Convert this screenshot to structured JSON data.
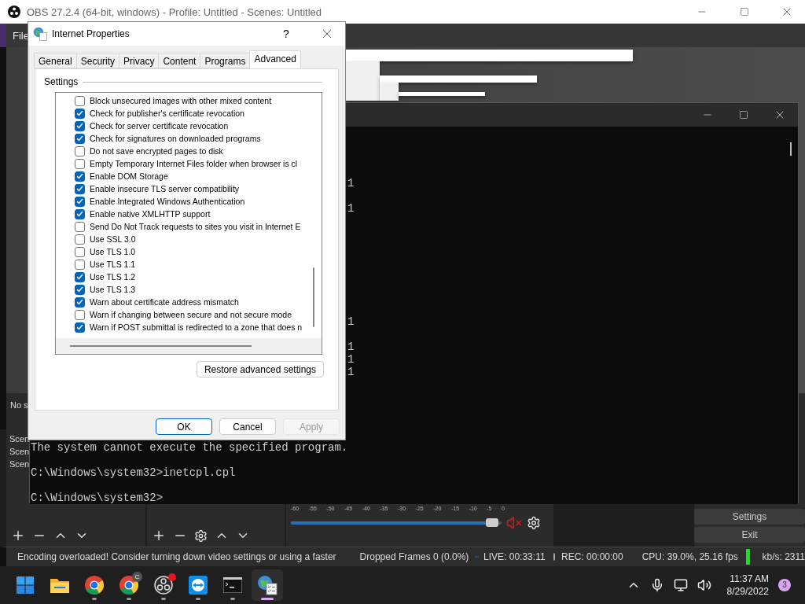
{
  "obs": {
    "title": "OBS 27.2.4 (64-bit, windows) - Profile: Untitled - Scenes: Untitled",
    "menu": [
      "File"
    ],
    "context_bar": "No s",
    "scenes": [
      "Scen",
      "Scen",
      "Scen"
    ],
    "mixer": {
      "ticks": [
        "-60",
        "-55",
        "-50",
        "-45",
        "-40",
        "-35",
        "-30",
        "-25",
        "-20",
        "-15",
        "-10",
        "-5",
        "0"
      ],
      "level": 0.97,
      "muted": true
    },
    "controls": [
      "Settings",
      "Exit"
    ],
    "status_bar": {
      "message": "Encoding overloaded! Consider turning down video settings or using a faster",
      "dropped_frames": "Dropped Frames 0 (0.0%)",
      "live": "LIVE: 00:33:11",
      "rec": "REC: 00:00:00",
      "cpu": "CPU: 39.0%, 25.16 fps",
      "bitrate": "kb/s: 2311"
    }
  },
  "terminal": {
    "lines": [
      {
        "kind": "blank"
      },
      {
        "kind": "blank"
      },
      {
        "kind": "blank"
      },
      {
        "kind": "blank"
      },
      {
        "kind": "fragment",
        "text": "1"
      },
      {
        "kind": "blank"
      },
      {
        "kind": "fragment",
        "text": "1"
      },
      {
        "kind": "blank"
      },
      {
        "kind": "blank"
      },
      {
        "kind": "blank"
      },
      {
        "kind": "blank"
      },
      {
        "kind": "blank"
      },
      {
        "kind": "blank"
      },
      {
        "kind": "blank"
      },
      {
        "kind": "blank"
      },
      {
        "kind": "fragment",
        "text": "1"
      },
      {
        "kind": "blank"
      },
      {
        "kind": "fragment",
        "text": "1"
      },
      {
        "kind": "fragment",
        "text": "1"
      },
      {
        "kind": "fragment",
        "text": "1"
      },
      {
        "kind": "blank"
      },
      {
        "kind": "blank"
      },
      {
        "kind": "blank"
      },
      {
        "kind": "blank"
      },
      {
        "kind": "blank"
      },
      {
        "kind": "text",
        "text": "The system cannot execute the specified program."
      },
      {
        "kind": "blank"
      },
      {
        "kind": "text",
        "text": "C:\\Windows\\system32>inetcpl.cpl"
      },
      {
        "kind": "blank"
      },
      {
        "kind": "text",
        "text": "C:\\Windows\\system32>"
      }
    ]
  },
  "dialog": {
    "title": "Internet Properties",
    "help": "?",
    "tabs": [
      {
        "label": "General",
        "selected": false
      },
      {
        "label": "Security",
        "selected": false
      },
      {
        "label": "Privacy",
        "selected": false
      },
      {
        "label": "Content",
        "selected": false
      },
      {
        "label": "Programs",
        "selected": false
      },
      {
        "label": "Advanced",
        "selected": true
      }
    ],
    "group": "Settings",
    "settings": [
      {
        "label": "Block unsecured images with other mixed content",
        "checked": false
      },
      {
        "label": "Check for publisher's certificate revocation",
        "checked": true
      },
      {
        "label": "Check for server certificate revocation",
        "checked": true
      },
      {
        "label": "Check for signatures on downloaded programs",
        "checked": true
      },
      {
        "label": "Do not save encrypted pages to disk",
        "checked": false
      },
      {
        "label": "Empty Temporary Internet Files folder when browser is cl",
        "checked": false
      },
      {
        "label": "Enable DOM Storage",
        "checked": true
      },
      {
        "label": "Enable insecure TLS server compatibility",
        "checked": true
      },
      {
        "label": "Enable Integrated Windows Authentication",
        "checked": true
      },
      {
        "label": "Enable native XMLHTTP support",
        "checked": true
      },
      {
        "label": "Send Do Not Track requests to sites you visit in Internet E",
        "checked": false
      },
      {
        "label": "Use SSL 3.0",
        "checked": false
      },
      {
        "label": "Use TLS 1.0",
        "checked": false
      },
      {
        "label": "Use TLS 1.1",
        "checked": false
      },
      {
        "label": "Use TLS 1.2",
        "checked": true
      },
      {
        "label": "Use TLS 1.3",
        "checked": true
      },
      {
        "label": "Warn about certificate address mismatch",
        "checked": true
      },
      {
        "label": "Warn if changing between secure and not secure mode",
        "checked": false
      },
      {
        "label": "Warn if POST submittal is redirected to a zone that does n",
        "checked": true
      }
    ],
    "restore_button": "Restore advanced settings",
    "buttons": [
      {
        "label": "OK",
        "kind": "default",
        "disabled": false
      },
      {
        "label": "Cancel",
        "kind": "normal",
        "disabled": false
      },
      {
        "label": "Apply",
        "kind": "normal",
        "disabled": true
      }
    ]
  },
  "taskbar": {
    "apps": [
      {
        "kind": "start",
        "running": false,
        "selected": false
      },
      {
        "kind": "folder",
        "running": false,
        "selected": false
      },
      {
        "kind": "browser",
        "running": true,
        "selected": false
      },
      {
        "kind": "browser",
        "running": true,
        "selected": false,
        "badge": "C"
      },
      {
        "kind": "recorder",
        "running": true,
        "selected": false,
        "alert": true
      },
      {
        "kind": "remote",
        "running": true,
        "selected": false
      },
      {
        "kind": "terminal",
        "running": true,
        "selected": false
      },
      {
        "kind": "settings",
        "running": true,
        "selected": true
      }
    ],
    "clock": {
      "time": "11:37 AM",
      "date": "8/29/2022"
    },
    "notifications": "3"
  }
}
